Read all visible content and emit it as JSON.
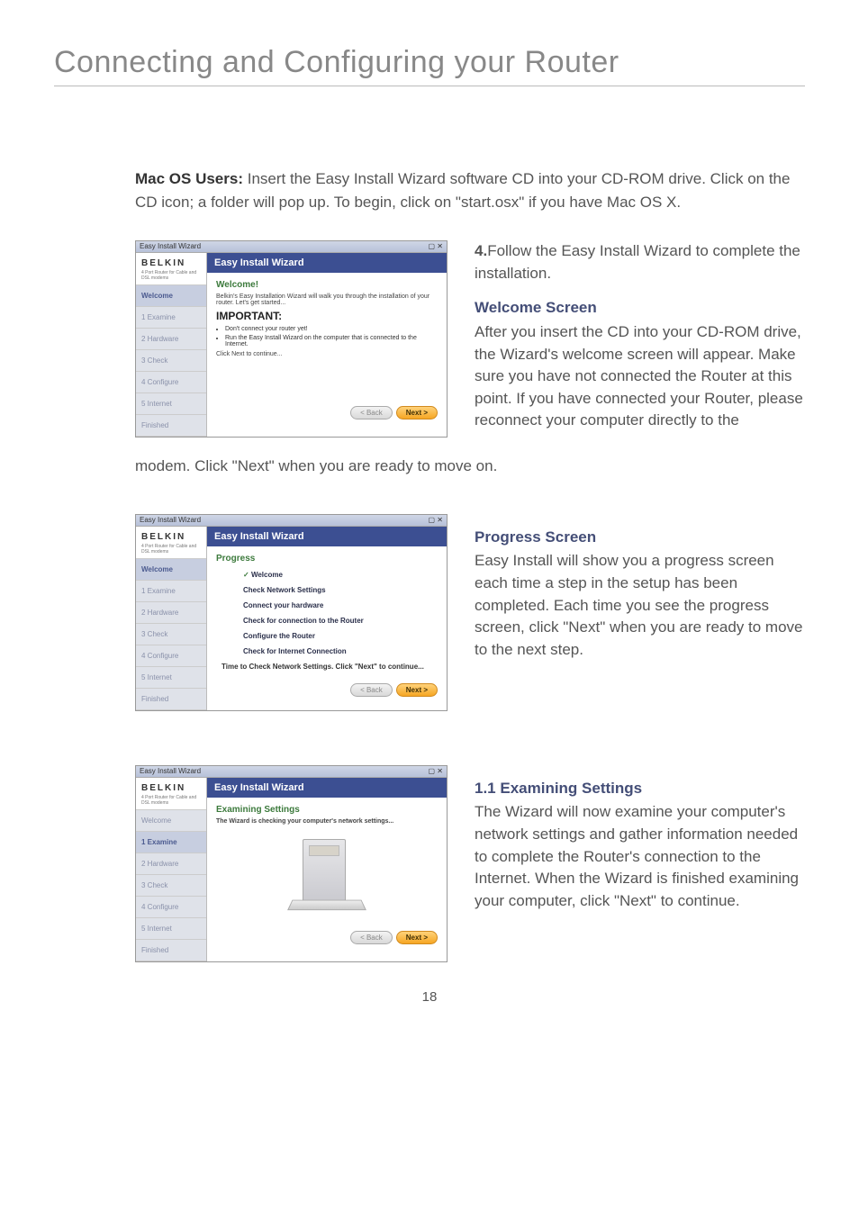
{
  "title": "Connecting and Configuring your Router",
  "intro": {
    "lead": "Mac OS Users:",
    "body": " Insert the Easy Install Wizard software CD into your CD-ROM drive. Click on the CD icon; a folder will pop up. To begin, click on \"start.osx\" if you have Mac OS X."
  },
  "wizard_common": {
    "window_title": "Easy Install Wizard",
    "banner": "Easy Install Wizard",
    "logo": "BELKIN",
    "sublogo": "4 Port Router for Cable and DSL modems",
    "back_btn": "< Back",
    "next_btn": "Next >"
  },
  "sidebar_steps": [
    "Welcome",
    "1 Examine",
    "2 Hardware",
    "3 Check",
    "4 Configure",
    "5 Internet",
    "Finished"
  ],
  "wiz1": {
    "active_step": 0,
    "heading": "Welcome!",
    "line1": "Belkin's Easy Installation Wizard will walk you through the installation of your router. Let's get started...",
    "important": "IMPORTANT:",
    "bullet1": "Don't connect your router yet!",
    "bullet2": "Run the Easy Install Wizard on the computer that is connected to the Internet.",
    "line2": "Click Next to continue..."
  },
  "step4_text": {
    "lead": "4.",
    "body": "Follow the Easy Install Wizard to complete the installation."
  },
  "welcome_block": {
    "heading": "Welcome Screen",
    "body_part1": "After you insert the CD into your CD-ROM drive, the Wizard's welcome screen will appear. Make sure you have not connected the Router at this point. If you have connected your Router, please reconnect your computer directly to the ",
    "wrap": "modem. Click \"Next\" when you are ready to move on."
  },
  "wiz2": {
    "active_step": 0,
    "heading": "Progress",
    "items": [
      "Welcome",
      "Check Network Settings",
      "Connect your hardware",
      "Check for connection to the Router",
      "Configure the Router",
      "Check for Internet Connection"
    ],
    "note": "Time to Check Network Settings. Click \"Next\" to continue..."
  },
  "progress_block": {
    "heading": "Progress Screen",
    "body": "Easy Install will show you a progress screen each time a step in the setup has been completed. Each time you see the progress screen, click \"Next\" when you are ready to move to the next step."
  },
  "wiz3": {
    "active_step": 1,
    "heading": "Examining Settings",
    "line1": "The Wizard is checking your computer's network settings..."
  },
  "examining_block": {
    "heading": "1.1 Examining Settings",
    "body": "The Wizard will now examine your computer's network settings and gather information needed to complete the Router's connection to the Internet. When the Wizard is finished examining your computer, click \"Next\" to continue."
  },
  "page_number": "18"
}
